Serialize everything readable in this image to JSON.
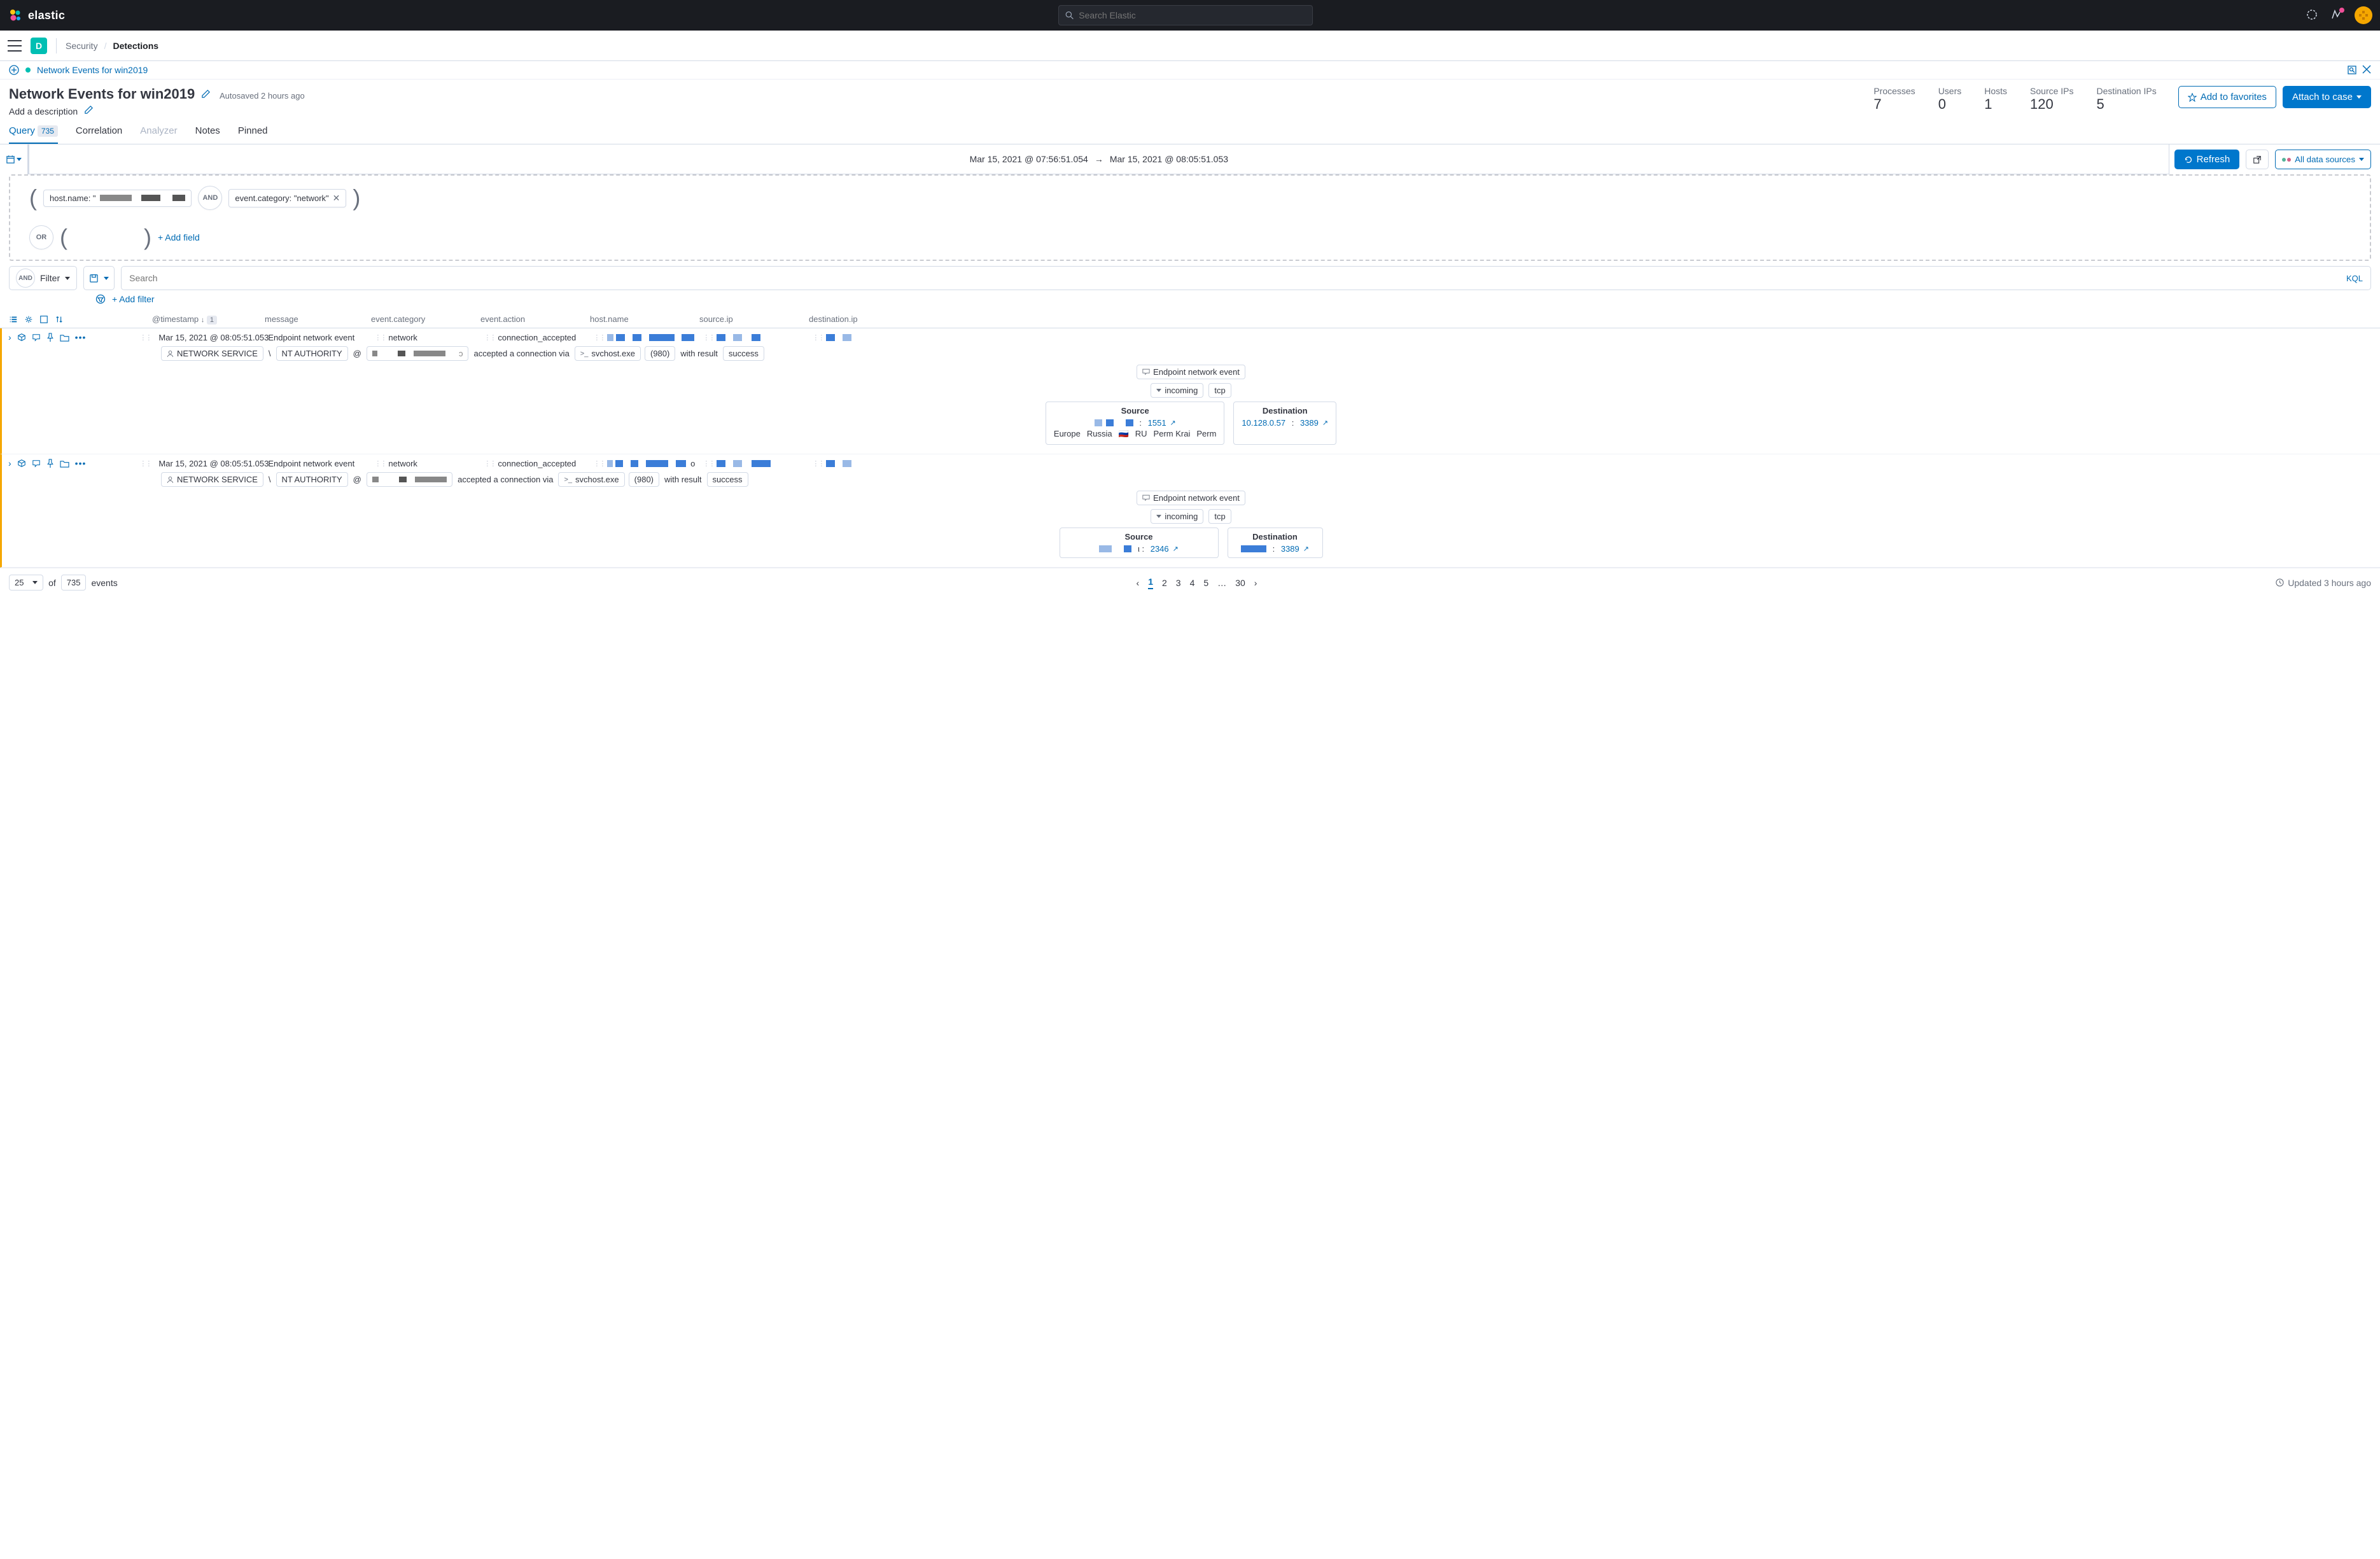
{
  "brand": "elastic",
  "search_placeholder": "Search Elastic",
  "app_initial": "D",
  "breadcrumb": {
    "parent": "Security",
    "current": "Detections"
  },
  "timeline_link": "Network Events for win2019",
  "title": "Network Events for win2019",
  "autosave": "Autosaved 2 hours ago",
  "description_prompt": "Add a description",
  "stats": [
    {
      "label": "Processes",
      "value": "7"
    },
    {
      "label": "Users",
      "value": "0"
    },
    {
      "label": "Hosts",
      "value": "1"
    },
    {
      "label": "Source IPs",
      "value": "120"
    },
    {
      "label": "Destination IPs",
      "value": "5"
    }
  ],
  "buttons": {
    "favorite": "Add to favorites",
    "attach": "Attach to case"
  },
  "tabs": {
    "query": "Query",
    "query_count": "735",
    "correlation": "Correlation",
    "analyzer": "Analyzer",
    "notes": "Notes",
    "pinned": "Pinned"
  },
  "date_range": {
    "from": "Mar 15, 2021 @ 07:56:51.054",
    "to": "Mar 15, 2021 @ 08:05:51.053"
  },
  "refresh": "Refresh",
  "data_sources": "All data sources",
  "query_pills": {
    "host": "host.name: \"",
    "event_cat": "event.category: \"network\"",
    "and": "AND",
    "or": "OR",
    "add_field": "+ Add field"
  },
  "filter": {
    "and": "AND",
    "label": "Filter",
    "search_placeholder": "Search",
    "kql": "KQL",
    "add_filter": "+ Add filter"
  },
  "columns": [
    "@timestamp",
    "message",
    "event.category",
    "event.action",
    "host.name",
    "source.ip",
    "destination.ip"
  ],
  "sort_badge": "1",
  "rows": [
    {
      "timestamp": "Mar 15, 2021 @ 08:05:51.053",
      "message": "Endpoint network event",
      "category": "network",
      "action": "connection_accepted",
      "detail": {
        "user": "NETWORK SERVICE",
        "domain": "NT AUTHORITY",
        "at": "@",
        "text": "accepted a connection via",
        "proc": "svchost.exe",
        "pid": "(980)",
        "with": "with result",
        "result": "success",
        "event_msg": "Endpoint network event",
        "direction": "incoming",
        "proto": "tcp",
        "source_hd": "Source",
        "dest_hd": "Destination",
        "src_port": "1551",
        "dest_ip": "10.128.0.57",
        "dest_port": "3389",
        "geo": [
          "Europe",
          "Russia",
          "RU",
          "Perm Krai",
          "Perm"
        ]
      }
    },
    {
      "timestamp": "Mar 15, 2021 @ 08:05:51.053",
      "message": "Endpoint network event",
      "category": "network",
      "action": "connection_accepted",
      "detail": {
        "user": "NETWORK SERVICE",
        "domain": "NT AUTHORITY",
        "at": "@",
        "text": "accepted a connection via",
        "proc": "svchost.exe",
        "pid": "(980)",
        "with": "with result",
        "result": "success",
        "event_msg": "Endpoint network event",
        "direction": "incoming",
        "proto": "tcp",
        "source_hd": "Source",
        "dest_hd": "Destination",
        "src_port": "2346",
        "dest_port": "3389"
      }
    }
  ],
  "pagination": {
    "page_size": "25",
    "of": "of",
    "total": "735",
    "events": "events",
    "pages": [
      "1",
      "2",
      "3",
      "4",
      "5",
      "…",
      "30"
    ]
  },
  "updated": "Updated 3 hours ago"
}
